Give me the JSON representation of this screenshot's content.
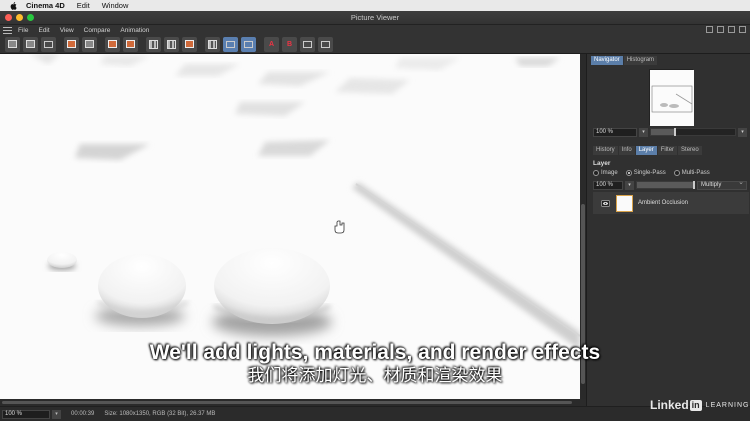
{
  "mac_menubar": {
    "app": "Cinema 4D",
    "items": [
      "Edit",
      "Window"
    ]
  },
  "window": {
    "title": "Picture Viewer"
  },
  "app_menu": {
    "items": [
      "File",
      "Edit",
      "View",
      "Compare",
      "Animation"
    ]
  },
  "toolbar": {
    "buttons": [
      "open-icon",
      "save-icon",
      "stop-icon",
      "render-region-icon",
      "camera-icon",
      "copy-icon",
      "ab-compare-icon",
      "layer-a-icon",
      "layer-b-icon",
      "channel-icon",
      "swap-icon",
      "split-icon",
      "color-a-icon",
      "color-b-icon",
      "grid-icon",
      "nav-icon"
    ],
    "active": [
      "split-icon",
      "swap-icon"
    ]
  },
  "panel": {
    "top_tabs": [
      "Navigator",
      "Histogram"
    ],
    "top_tab_active": "Navigator",
    "nav_zoom": "100 %",
    "nav_zoom_fraction": 0.28,
    "bottom_tabs": [
      "History",
      "Info",
      "Layer",
      "Filter",
      "Stereo"
    ],
    "bottom_tab_active": "Layer",
    "layer": {
      "title": "Layer",
      "modes": [
        "Image",
        "Single-Pass",
        "Multi-Pass"
      ],
      "mode_selected": "Single-Pass",
      "opacity": "100 %",
      "opacity_fraction": 1.0,
      "blend_mode": "Multiply",
      "items": [
        {
          "name": "Ambient Occlusion"
        }
      ]
    }
  },
  "statusbar": {
    "zoom": "100 %",
    "time": "00:00:39",
    "info": "Size: 1080x1350, RGB (32 Bit), 26.37 MB"
  },
  "subtitles": {
    "en": "We'll add lights, materials, and render effects",
    "zh": "我们将添加灯光、材质和渲染效果"
  },
  "watermark": {
    "brand": "Linked",
    "in": "in",
    "suffix": "LEARNING"
  }
}
